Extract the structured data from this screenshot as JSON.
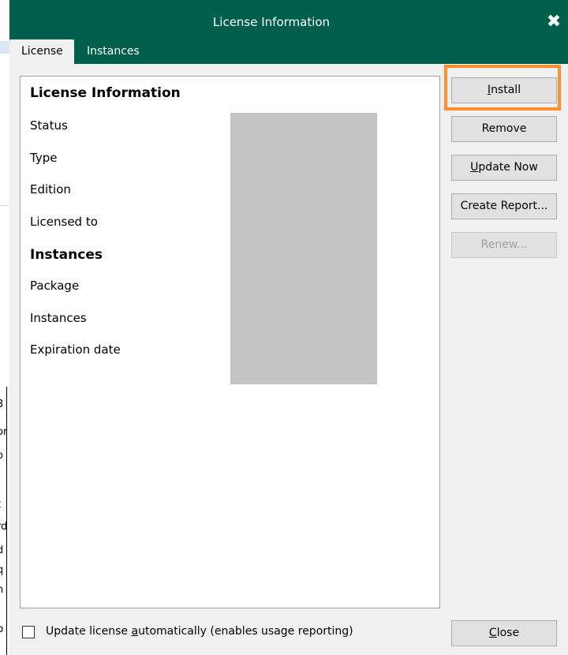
{
  "window": {
    "title": "License Information",
    "close_glyph": "✖"
  },
  "tabs": [
    {
      "label": "License",
      "active": true
    },
    {
      "label": "Instances",
      "active": false
    }
  ],
  "panel": {
    "license_heading": "License Information",
    "license_fields": [
      "Status",
      "Type",
      "Edition",
      "Licensed to"
    ],
    "instances_heading": "Instances",
    "instances_fields": [
      "Package",
      "Instances",
      "Expiration date"
    ]
  },
  "buttons": {
    "install": {
      "pre": "",
      "key": "I",
      "post": "nstall"
    },
    "remove": "Remove",
    "update_now": {
      "pre": "",
      "key": "U",
      "post": "pdate Now"
    },
    "create_report": "Create Report...",
    "renew": "Renew...",
    "close": {
      "pre": "",
      "key": "C",
      "post": "lose"
    }
  },
  "auto_update": {
    "checked": false,
    "label_pre": "Update license ",
    "label_key": "a",
    "label_post": "utomatically (enables usage reporting)"
  },
  "background_fragments": [
    "3",
    "or",
    "o",
    "t",
    "rd",
    "d",
    "q",
    "n",
    "p"
  ],
  "colors": {
    "titlebar": "#005f4b",
    "highlight": "#ff8f2a"
  }
}
